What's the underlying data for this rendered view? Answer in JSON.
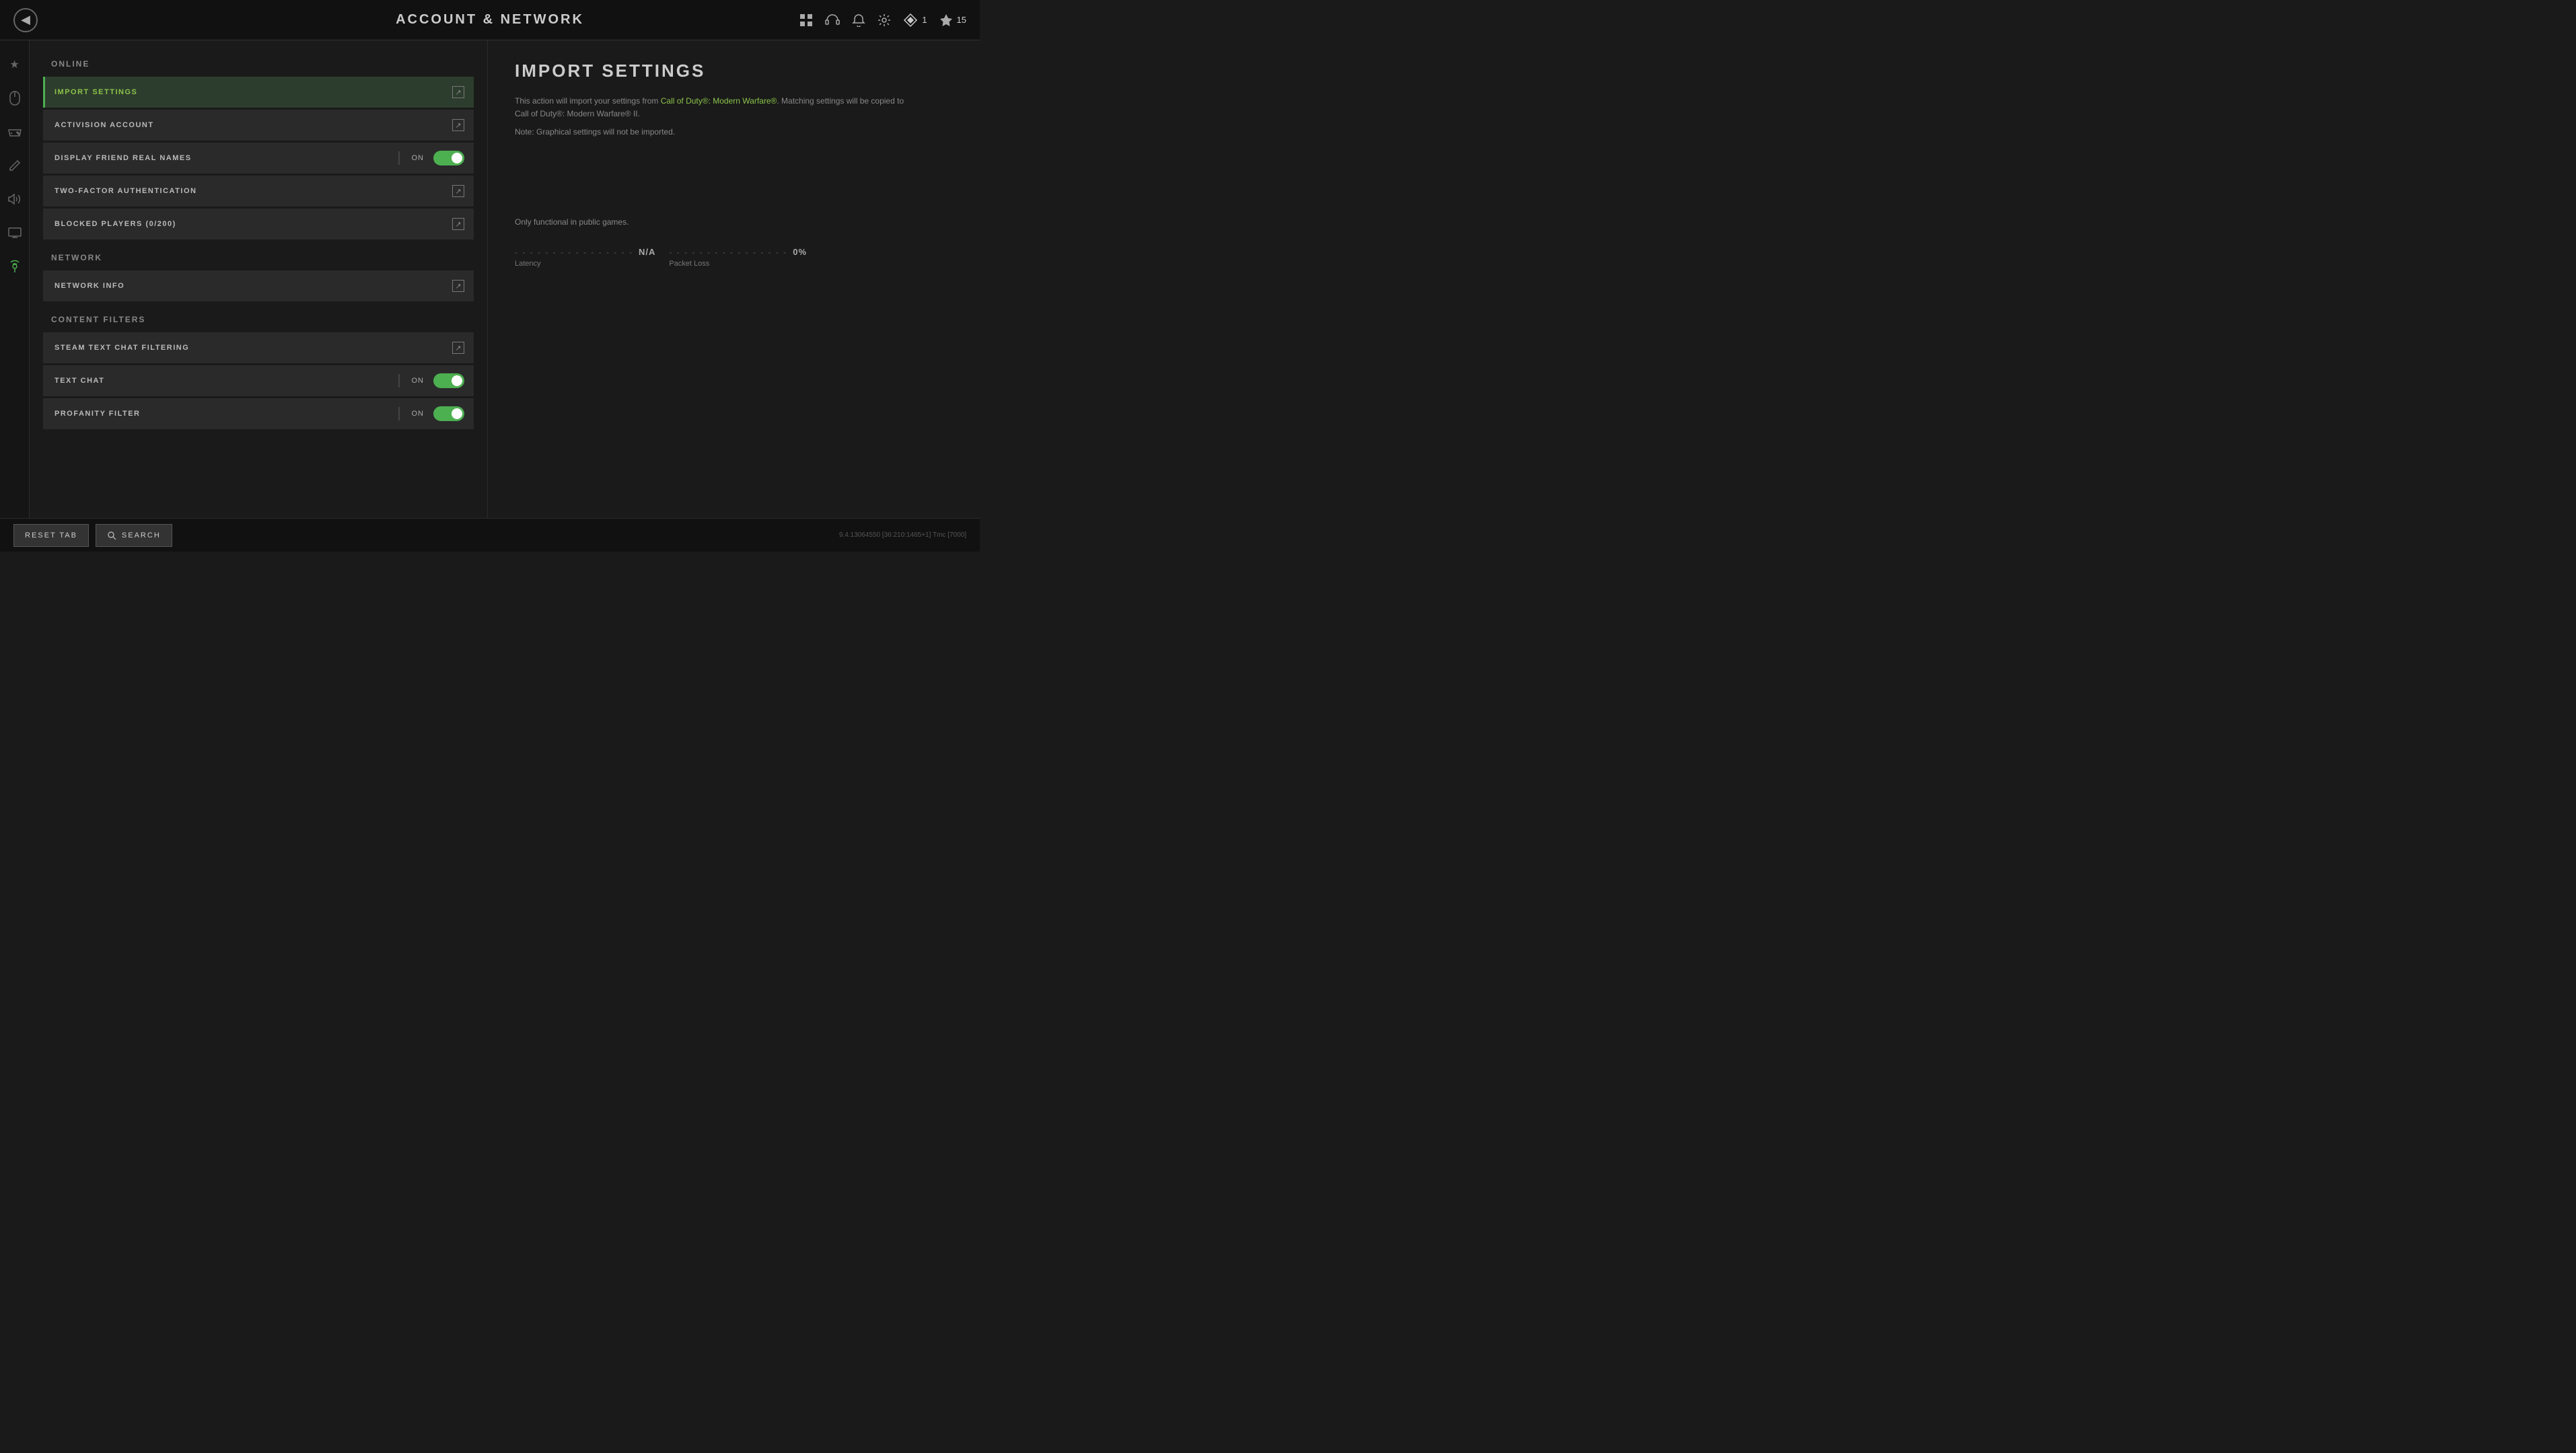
{
  "header": {
    "back_label": "‹",
    "title": "ACCOUNT & NETWORK",
    "icons": {
      "grid": "⊞",
      "headset": "🎧",
      "bell": "🔔",
      "gear": "⚙",
      "rank_num": "1",
      "currency_icon": "❖",
      "currency_val": "15"
    }
  },
  "sidebar": {
    "icons": [
      {
        "name": "star-icon",
        "symbol": "★",
        "active": false
      },
      {
        "name": "mouse-icon",
        "symbol": "⊙",
        "active": false
      },
      {
        "name": "controller-icon",
        "symbol": "⊡",
        "active": false
      },
      {
        "name": "pencil-icon",
        "symbol": "✎",
        "active": false
      },
      {
        "name": "speaker-icon",
        "symbol": "◈",
        "active": false
      },
      {
        "name": "display-icon",
        "symbol": "▤",
        "active": false
      },
      {
        "name": "antenna-icon",
        "symbol": "⊛",
        "active": true
      }
    ]
  },
  "settings": {
    "sections": [
      {
        "id": "online",
        "header": "ONLINE",
        "items": [
          {
            "id": "import-settings",
            "label": "IMPORT SETTINGS",
            "type": "link",
            "active": true
          },
          {
            "id": "activision-account",
            "label": "ACTIVISION ACCOUNT",
            "type": "link",
            "active": false
          },
          {
            "id": "display-friend-names",
            "label": "DISPLAY FRIEND REAL NAMES",
            "type": "toggle",
            "value": "ON",
            "active": false
          },
          {
            "id": "two-factor-auth",
            "label": "TWO-FACTOR AUTHENTICATION",
            "type": "link",
            "active": false
          },
          {
            "id": "blocked-players",
            "label": "BLOCKED PLAYERS (0/200)",
            "type": "link",
            "active": false
          }
        ]
      },
      {
        "id": "network",
        "header": "NETWORK",
        "items": [
          {
            "id": "network-info",
            "label": "NETWORK INFO",
            "type": "link",
            "active": false
          }
        ]
      },
      {
        "id": "content-filters",
        "header": "CONTENT FILTERS",
        "items": [
          {
            "id": "steam-text-chat",
            "label": "STEAM TEXT CHAT FILTERING",
            "type": "link",
            "active": false
          },
          {
            "id": "text-chat",
            "label": "TEXT CHAT",
            "type": "toggle",
            "value": "ON",
            "active": false
          },
          {
            "id": "profanity-filter",
            "label": "PROFANITY FILTER",
            "type": "toggle",
            "value": "ON",
            "active": false
          }
        ]
      }
    ]
  },
  "right_panel": {
    "title": "IMPORT SETTINGS",
    "description_prefix": "This action will import your settings from ",
    "description_highlight": "Call of Duty®: Modern Warfare®",
    "description_suffix": ". Matching settings will be copied to Call of Duty®: Modern Warfare® II.",
    "note": "Note: Graphical settings will not be imported.",
    "functional_note": "Only functional in public games.",
    "latency_label": "Latency",
    "latency_value": "N/A",
    "packet_loss_label": "Packet Loss",
    "packet_loss_value": "0%"
  },
  "bottom_bar": {
    "reset_tab_label": "RESET TAB",
    "search_label": "SEARCH",
    "version": "9.4.13064550 [36:210:1465+1] Tmc [7000]"
  }
}
